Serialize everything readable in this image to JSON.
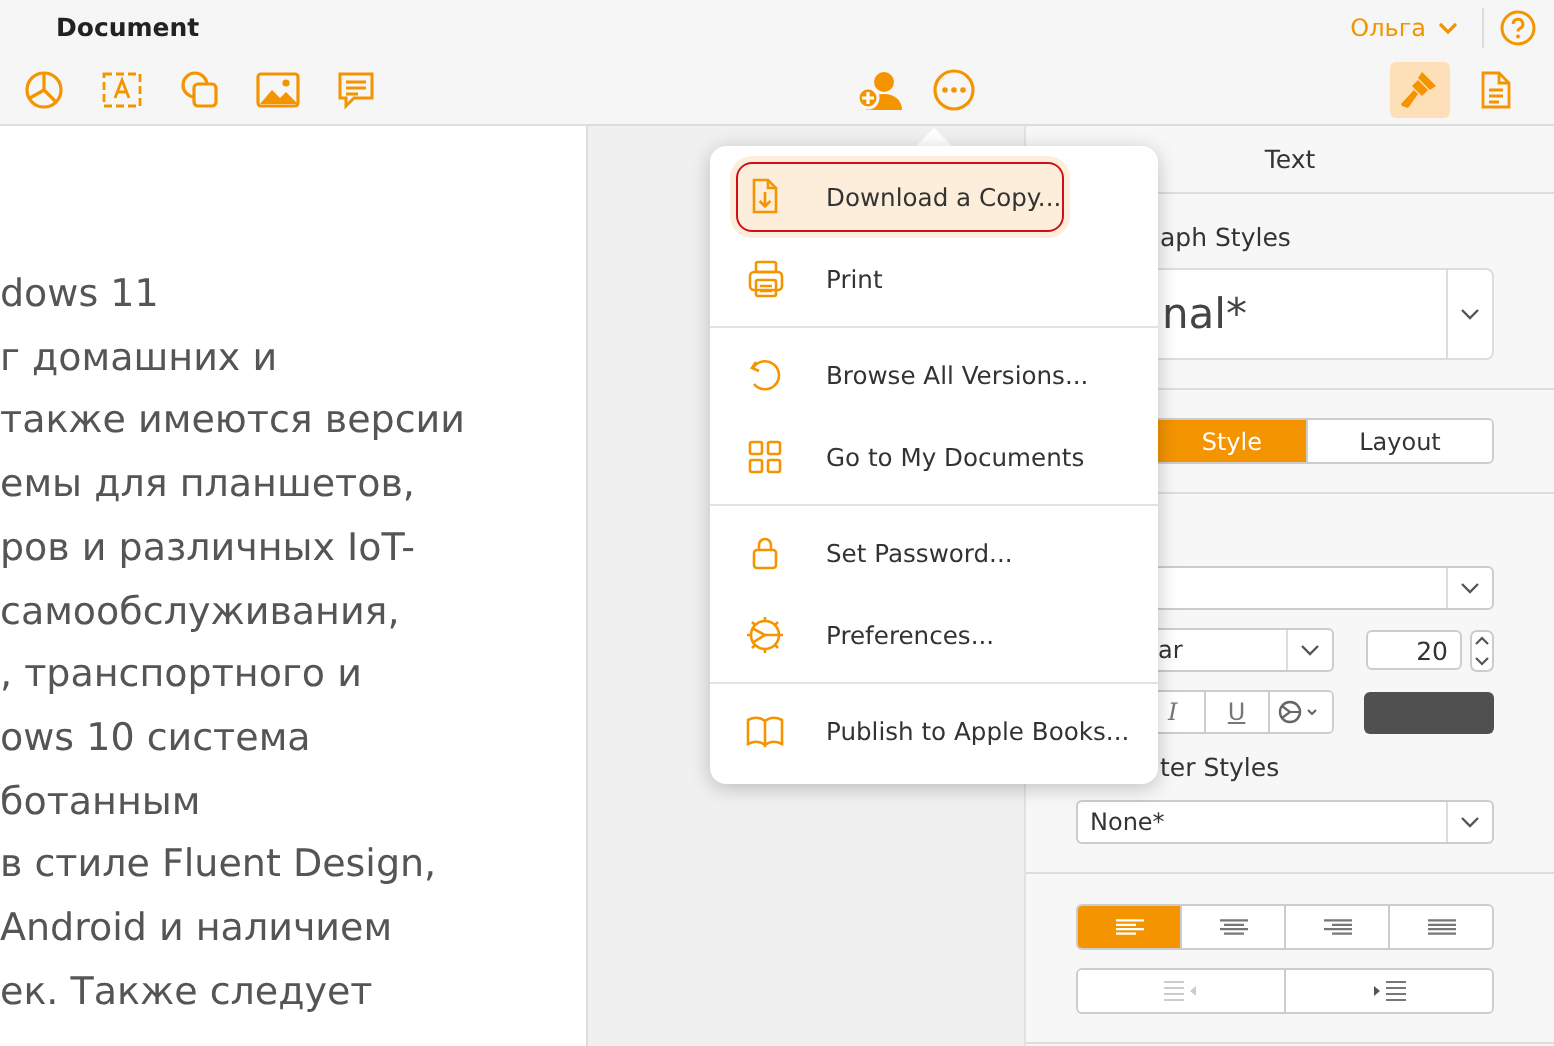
{
  "window": {
    "title": "Document"
  },
  "account": {
    "user": "Ольга"
  },
  "toolbar": {
    "right": [
      {
        "selected": true
      },
      {
        "selected": false
      }
    ]
  },
  "document": {
    "lines": [
      "dows 11",
      "г домашних и",
      "также имеются версии",
      "емы для планшетов,",
      "ров и различных IoT-",
      "самообслуживания,",
      ", транспортного и",
      "ows 10 система",
      "ботанным",
      "в стиле Fluent Design,",
      "Android и наличием",
      "ек. Также следует"
    ]
  },
  "menu": {
    "groups": [
      [
        {
          "label": "Download a Copy...",
          "selected": true,
          "outlined": true
        },
        {
          "label": "Print",
          "selected": false,
          "outlined": false
        }
      ],
      [
        {
          "label": "Browse All Versions...",
          "selected": false,
          "outlined": false
        },
        {
          "label": "Go to My Documents",
          "selected": false,
          "outlined": false
        }
      ],
      [
        {
          "label": "Set Password...",
          "selected": false,
          "outlined": false
        },
        {
          "label": "Preferences...",
          "selected": false,
          "outlined": false
        }
      ],
      [
        {
          "label": "Publish to Apple Books...",
          "selected": false,
          "outlined": false
        }
      ]
    ]
  },
  "inspector": {
    "header": "Text",
    "paragraph_styles_label": "aph Styles",
    "paragraph_style": "nal*",
    "tabs": [
      {
        "label": "Style",
        "selected": true
      },
      {
        "label": "Layout",
        "selected": false
      }
    ],
    "font_style": "ar",
    "font_size": "20",
    "format_buttons": [
      "I",
      "U"
    ],
    "character_styles_label": "ter Styles",
    "character_style": "None*",
    "alignment": [
      {
        "selected": true
      },
      {
        "selected": false
      },
      {
        "selected": false
      },
      {
        "selected": false
      }
    ]
  }
}
